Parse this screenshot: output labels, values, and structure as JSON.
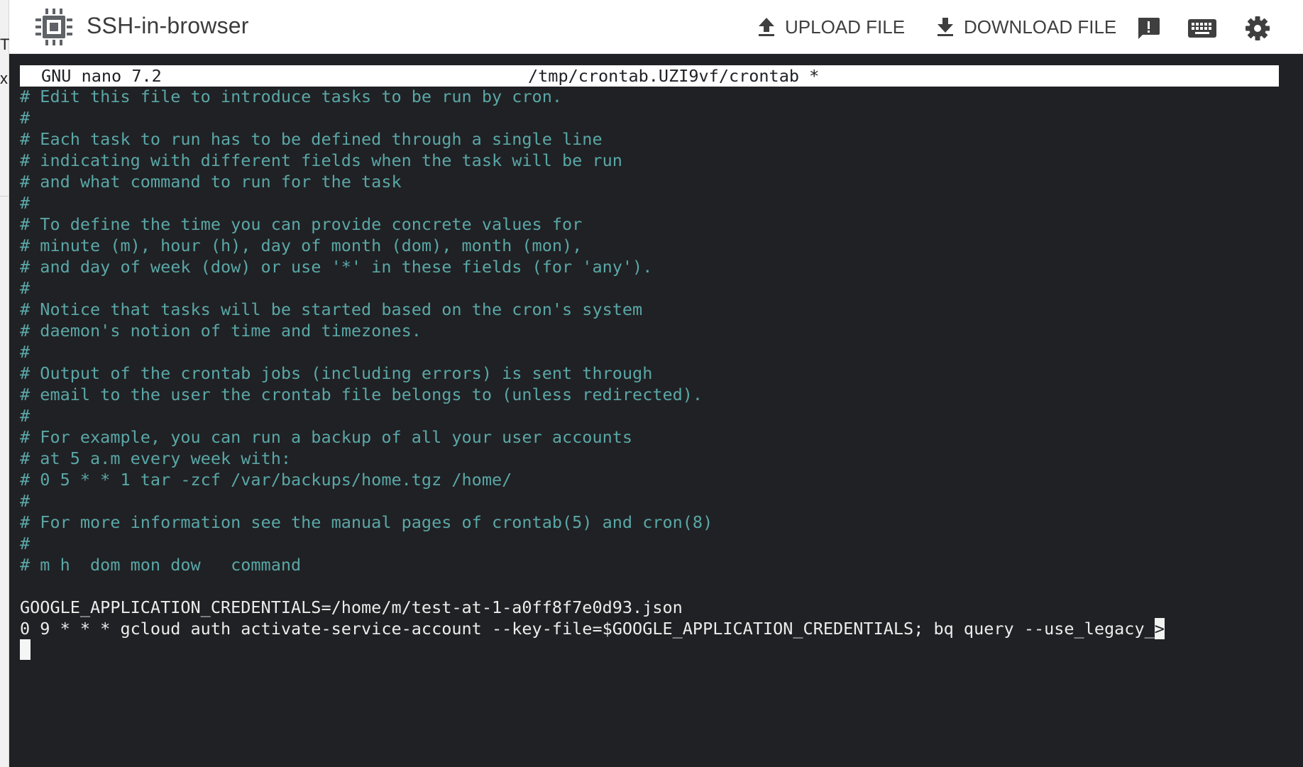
{
  "app": {
    "title": "SSH-in-browser",
    "chip_icon": "chip-icon"
  },
  "left_sliver": {
    "glyph_top": "T",
    "glyph_mid": "x"
  },
  "toolbar": {
    "upload_label": "UPLOAD FILE",
    "upload_icon": "upload-icon",
    "download_label": "DOWNLOAD FILE",
    "download_icon": "download-icon",
    "feedback_icon": "feedback-icon",
    "keyboard_icon": "keyboard-icon",
    "settings_icon": "gear-icon"
  },
  "editor": {
    "name": "GNU nano 7.2",
    "file_path": "/tmp/crontab.UZI9vf/crontab *",
    "lines": [
      {
        "kind": "comment",
        "text": "# Edit this file to introduce tasks to be run by cron."
      },
      {
        "kind": "comment",
        "text": "#"
      },
      {
        "kind": "comment",
        "text": "# Each task to run has to be defined through a single line"
      },
      {
        "kind": "comment",
        "text": "# indicating with different fields when the task will be run"
      },
      {
        "kind": "comment",
        "text": "# and what command to run for the task"
      },
      {
        "kind": "comment",
        "text": "#"
      },
      {
        "kind": "comment",
        "text": "# To define the time you can provide concrete values for"
      },
      {
        "kind": "comment",
        "text": "# minute (m), hour (h), day of month (dom), month (mon),"
      },
      {
        "kind": "comment",
        "text": "# and day of week (dow) or use '*' in these fields (for 'any')."
      },
      {
        "kind": "comment",
        "text": "#"
      },
      {
        "kind": "comment",
        "text": "# Notice that tasks will be started based on the cron's system"
      },
      {
        "kind": "comment",
        "text": "# daemon's notion of time and timezones."
      },
      {
        "kind": "comment",
        "text": "#"
      },
      {
        "kind": "comment",
        "text": "# Output of the crontab jobs (including errors) is sent through"
      },
      {
        "kind": "comment",
        "text": "# email to the user the crontab file belongs to (unless redirected)."
      },
      {
        "kind": "comment",
        "text": "#"
      },
      {
        "kind": "comment",
        "text": "# For example, you can run a backup of all your user accounts"
      },
      {
        "kind": "comment",
        "text": "# at 5 a.m every week with:"
      },
      {
        "kind": "comment",
        "text": "# 0 5 * * 1 tar -zcf /var/backups/home.tgz /home/"
      },
      {
        "kind": "comment",
        "text": "#"
      },
      {
        "kind": "comment",
        "text": "# For more information see the manual pages of crontab(5) and cron(8)"
      },
      {
        "kind": "comment",
        "text": "#"
      },
      {
        "kind": "comment",
        "text": "# m h  dom mon dow   command"
      },
      {
        "kind": "blank",
        "text": ""
      },
      {
        "kind": "code",
        "text": "GOOGLE_APPLICATION_CREDENTIALS=/home/m/test-at-1-a0ff8f7e0d93.json"
      },
      {
        "kind": "code",
        "text": "0 9 * * * gcloud auth activate-service-account --key-file=$GOOGLE_APPLICATION_CREDENTIALS; bq query --use_legacy_",
        "overflow": ">"
      }
    ]
  }
}
